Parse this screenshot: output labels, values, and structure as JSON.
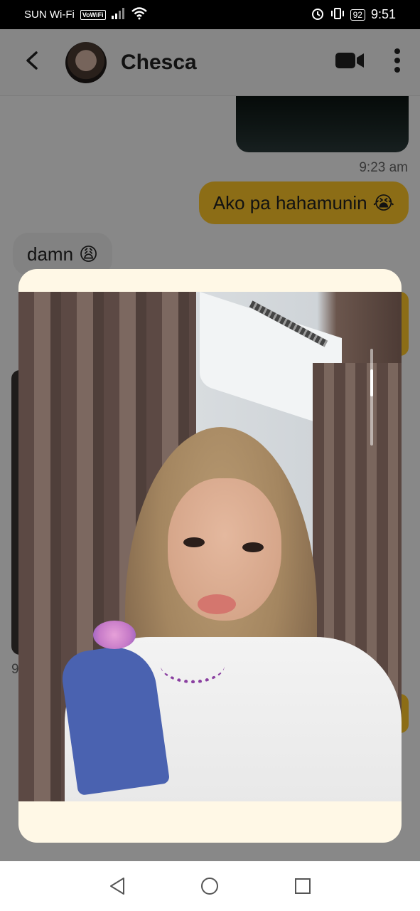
{
  "status_bar": {
    "carrier": "SUN Wi-Fi",
    "volte_label": "VoWiFi",
    "battery": "92",
    "time": "9:51"
  },
  "header": {
    "contact_name": "Chesca",
    "back_icon": "back-arrow-icon",
    "video_icon": "video-call-icon",
    "menu_icon": "more-vert-icon"
  },
  "messages": {
    "sent_timestamp": "9:23 am",
    "sent_text": "Ako pa hahamunin",
    "sent_emoji": "😭",
    "received_text": "damn",
    "received_emoji": "😩",
    "left_partial_timestamp": "9"
  },
  "photo_viewer": {
    "scroll_position": 0.3
  },
  "colors": {
    "accent": "#ffc629",
    "modal_bg": "#fff8e6"
  }
}
